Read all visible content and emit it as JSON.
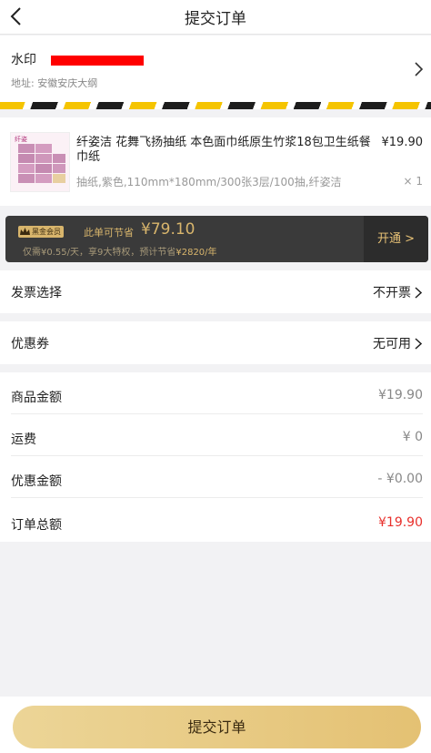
{
  "nav": {
    "title": "提交订单"
  },
  "address": {
    "name": "水印",
    "address": "地址: 安徽安庆大纲"
  },
  "product": {
    "title": "纤姿洁 花舞飞扬抽纸 本色面巾纸原生竹浆18包卫生纸餐巾纸",
    "price": "¥19.90",
    "spec": "抽纸,紫色,110mm*180mm/300张3层/100抽,纤姿洁",
    "qty": "× 1"
  },
  "member": {
    "badge": "黑金会员",
    "save_label": "此单可节省",
    "save_amount": "¥79.10",
    "sub_prefix": "仅需¥0.55/天，享9大特权，预计节省",
    "sub_highlight": "¥2820/年",
    "open_label": "开通 >"
  },
  "invoice": {
    "label": "发票选择",
    "value": "不开票"
  },
  "coupon": {
    "label": "优惠券",
    "value": "无可用"
  },
  "amounts": [
    {
      "label": "商品金额",
      "value": "¥19.90"
    },
    {
      "label": "运费",
      "value": "¥ 0"
    },
    {
      "label": "优惠金额",
      "value": "- ¥0.00"
    },
    {
      "label": "订单总额",
      "value": "¥19.90"
    }
  ],
  "submit_label": "提交订单",
  "colors": {
    "total_red": "#e8302c",
    "gold": "#d8b56c",
    "button_gold": "#e4c173"
  }
}
